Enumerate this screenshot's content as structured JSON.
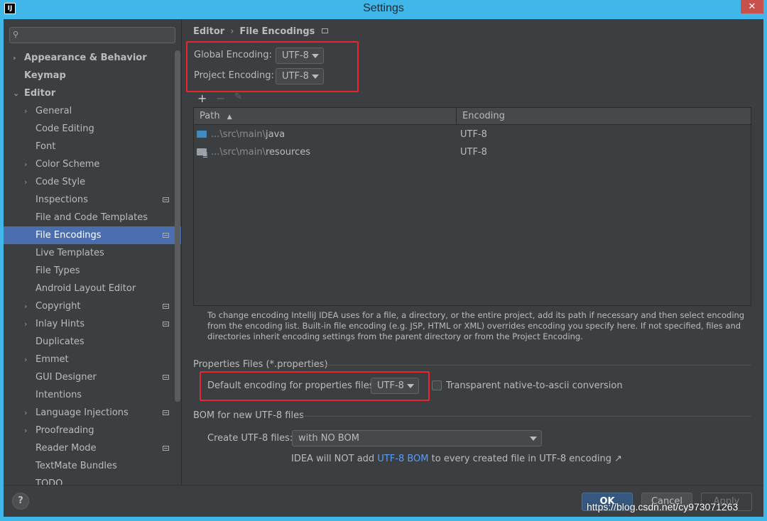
{
  "window": {
    "title": "Settings",
    "app_icon": "IJ",
    "close_glyph": "✕"
  },
  "sidebar": {
    "search_placeholder": "",
    "items": [
      {
        "label": "Appearance & Behavior",
        "level": 0,
        "arrow": "›"
      },
      {
        "label": "Keymap",
        "level": 0,
        "arrow": ""
      },
      {
        "label": "Editor",
        "level": 0,
        "arrow": "⌄"
      },
      {
        "label": "General",
        "level": 1,
        "arrow": "›"
      },
      {
        "label": "Code Editing",
        "level": 1,
        "arrow": ""
      },
      {
        "label": "Font",
        "level": 1,
        "arrow": ""
      },
      {
        "label": "Color Scheme",
        "level": 1,
        "arrow": "›"
      },
      {
        "label": "Code Style",
        "level": 1,
        "arrow": "›"
      },
      {
        "label": "Inspections",
        "level": 1,
        "arrow": "",
        "project": true
      },
      {
        "label": "File and Code Templates",
        "level": 1,
        "arrow": ""
      },
      {
        "label": "File Encodings",
        "level": 1,
        "arrow": "",
        "project": true,
        "selected": true
      },
      {
        "label": "Live Templates",
        "level": 1,
        "arrow": ""
      },
      {
        "label": "File Types",
        "level": 1,
        "arrow": ""
      },
      {
        "label": "Android Layout Editor",
        "level": 1,
        "arrow": ""
      },
      {
        "label": "Copyright",
        "level": 1,
        "arrow": "›",
        "project": true
      },
      {
        "label": "Inlay Hints",
        "level": 1,
        "arrow": "›",
        "project": true
      },
      {
        "label": "Duplicates",
        "level": 1,
        "arrow": ""
      },
      {
        "label": "Emmet",
        "level": 1,
        "arrow": "›"
      },
      {
        "label": "GUI Designer",
        "level": 1,
        "arrow": "",
        "project": true
      },
      {
        "label": "Intentions",
        "level": 1,
        "arrow": ""
      },
      {
        "label": "Language Injections",
        "level": 1,
        "arrow": "›",
        "project": true
      },
      {
        "label": "Proofreading",
        "level": 1,
        "arrow": "›"
      },
      {
        "label": "Reader Mode",
        "level": 1,
        "arrow": "",
        "project": true
      },
      {
        "label": "TextMate Bundles",
        "level": 1,
        "arrow": ""
      },
      {
        "label": "TODO",
        "level": 1,
        "arrow": ""
      }
    ]
  },
  "breadcrumb": {
    "parent": "Editor",
    "separator": "›",
    "current": "File Encodings"
  },
  "global_encoding": {
    "label": "Global Encoding:",
    "value": "UTF-8"
  },
  "project_encoding": {
    "label": "Project Encoding:",
    "value": "UTF-8"
  },
  "toolbar": {
    "add": "+",
    "remove": "−",
    "edit": "✎"
  },
  "table": {
    "columns": [
      "Path",
      "Encoding"
    ],
    "sort_indicator": "▲",
    "rows": [
      {
        "path_prefix": "...\\src\\main\\",
        "path_name": "java",
        "encoding": "UTF-8",
        "icon": "source-folder-icon"
      },
      {
        "path_prefix": "...\\src\\main\\",
        "path_name": "resources",
        "encoding": "UTF-8",
        "icon": "resources-folder-icon"
      }
    ]
  },
  "help_text": "To change encoding IntelliJ IDEA uses for a file, a directory, or the entire project, add its path if necessary and then select encoding from the encoding list. Built-in file encoding (e.g. JSP, HTML or XML) overrides encoding you specify here. If not specified, files and directories inherit encoding settings from the parent directory or from the Project Encoding.",
  "properties": {
    "section_title": "Properties Files (*.properties)",
    "default_label": "Default encoding for properties files:",
    "default_value": "UTF-8",
    "transparent_label": "Transparent native-to-ascii conversion",
    "transparent_checked": false
  },
  "bom": {
    "section_title": "BOM for new UTF-8 files",
    "create_label": "Create UTF-8 files:",
    "create_value": "with NO BOM",
    "note_prefix": "IDEA will NOT add ",
    "note_link": "UTF-8 BOM",
    "note_suffix": " to every created file in UTF-8 encoding ↗"
  },
  "buttons": {
    "help": "?",
    "ok": "OK",
    "cancel": "Cancel",
    "apply": "Apply"
  },
  "watermark": "https://blog.csdn.net/cy973071263",
  "colors": {
    "titlebar": "#41b6e9",
    "selection": "#4b6eaf",
    "highlight_box": "#e8262b",
    "link": "#589df6"
  }
}
